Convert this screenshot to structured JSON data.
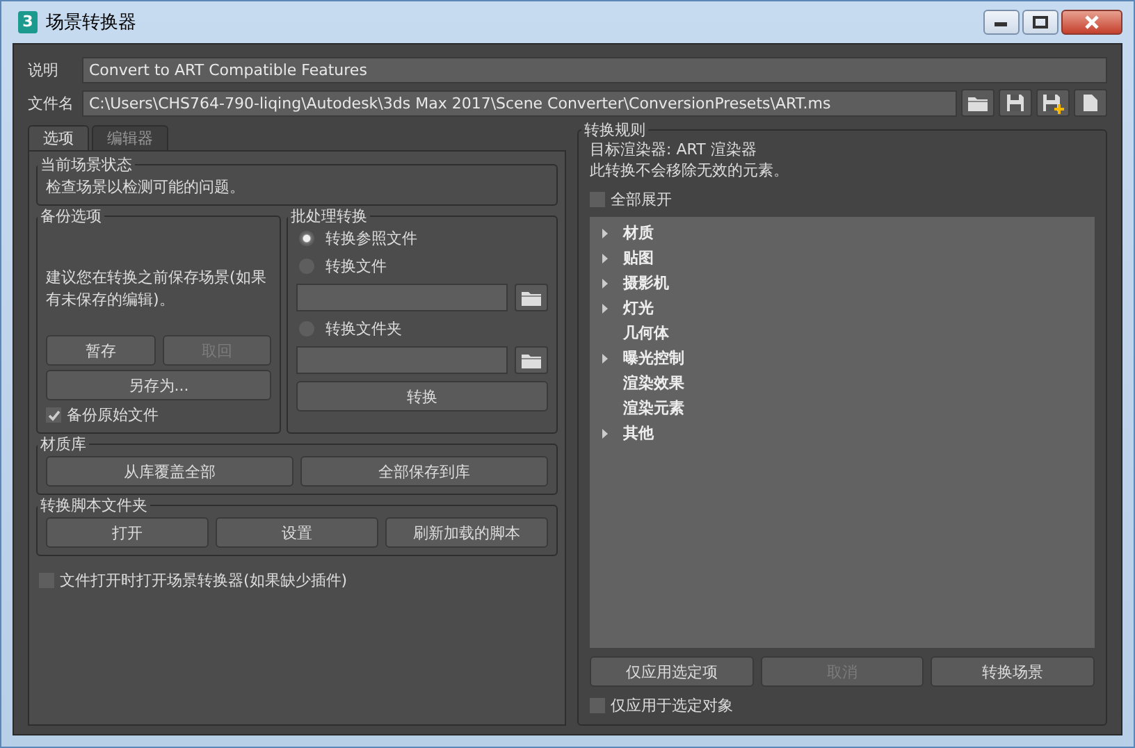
{
  "window": {
    "title": "场景转换器",
    "app_icon": "3"
  },
  "description": {
    "label": "说明",
    "value": "Convert to ART Compatible Features"
  },
  "file": {
    "label": "文件名",
    "value": "C:\\Users\\CHS764-790-liqing\\Autodesk\\3ds Max 2017\\Scene Converter\\ConversionPresets\\ART.ms"
  },
  "tabs": [
    {
      "label": "选项",
      "selected": true
    },
    {
      "label": "编辑器",
      "selected": false
    }
  ],
  "scene_status": {
    "title": "当前场景状态",
    "text": "检查场景以检测可能的问题。"
  },
  "backup": {
    "title": "备份选项",
    "text": "建议您在转换之前保存场景(如果有未保存的编辑)。",
    "buttons": [
      {
        "label": "暂存",
        "disabled": false
      },
      {
        "label": "取回",
        "disabled": true
      },
      {
        "label": "另存为...",
        "disabled": false
      }
    ],
    "checkbox": {
      "label": "备份原始文件",
      "checked": true
    }
  },
  "batch": {
    "title": "批处理转换",
    "options": [
      {
        "label": "转换参照文件",
        "selected": true,
        "kind": "plain"
      },
      {
        "label": "转换文件",
        "selected": false,
        "kind": "path"
      },
      {
        "label": "转换文件夹",
        "selected": false,
        "kind": "path"
      }
    ],
    "button": "转换"
  },
  "material_library": {
    "title": "材质库",
    "buttons": [
      "从库覆盖全部",
      "全部保存到库"
    ]
  },
  "script_folder": {
    "title": "转换脚本文件夹",
    "buttons": [
      "打开",
      "设置",
      "刷新加载的脚本"
    ]
  },
  "open_on_load": {
    "label": "文件打开时打开场景转换器(如果缺少插件)",
    "checked": false
  },
  "rules": {
    "title": "转换规则",
    "lines": [
      "目标渲染器: ART 渲染器",
      "此转换不会移除无效的元素。"
    ],
    "expand_all": {
      "label": "全部展开",
      "checked": false
    },
    "tree": [
      {
        "label": "材质",
        "expandable": true
      },
      {
        "label": "贴图",
        "expandable": true
      },
      {
        "label": "摄影机",
        "expandable": true
      },
      {
        "label": "灯光",
        "expandable": true
      },
      {
        "label": "几何体",
        "expandable": false
      },
      {
        "label": "曝光控制",
        "expandable": true
      },
      {
        "label": "渲染效果",
        "expandable": false
      },
      {
        "label": "渲染元素",
        "expandable": false
      },
      {
        "label": "其他",
        "expandable": true
      }
    ],
    "buttons": [
      {
        "label": "仅应用选定项",
        "disabled": false
      },
      {
        "label": "取消",
        "disabled": true
      },
      {
        "label": "转换场景",
        "disabled": false
      }
    ],
    "selected_only": {
      "label": "仅应用于选定对象",
      "checked": false
    }
  }
}
